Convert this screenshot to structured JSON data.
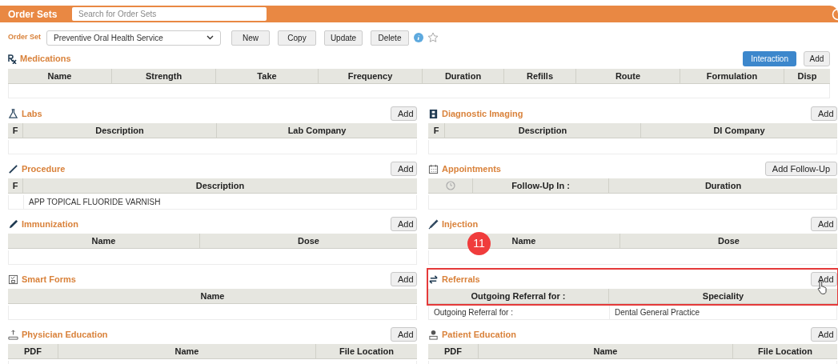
{
  "header": {
    "title": "Order Sets",
    "search": {
      "placeholder": "Search for Order Sets"
    }
  },
  "order_set": {
    "label": "Order Set",
    "value": "Preventive Oral Health Service",
    "buttons": [
      "New",
      "Copy",
      "Update",
      "Delete"
    ],
    "favorite": false
  },
  "medications": {
    "title": "Medications",
    "buttons": [
      {
        "label": "Interaction",
        "primary": true
      },
      {
        "label": "Add",
        "primary": false
      }
    ],
    "columns": [
      "Name",
      "Strength",
      "Take",
      "Frequency",
      "Duration",
      "Refills",
      "Route",
      "Formulation",
      "Disp"
    ]
  },
  "sections": [
    {
      "title": "Labs",
      "button": "Add",
      "highlighted": false,
      "columns": [
        {
          "kind": "text",
          "label": "F"
        },
        {
          "kind": "text",
          "label": "Description"
        },
        {
          "kind": "text",
          "label": "Lab Company"
        }
      ]
    },
    {
      "title": "Diagnostic Imaging",
      "button": "Add",
      "highlighted": false,
      "columns": [
        {
          "kind": "text",
          "label": "F"
        },
        {
          "kind": "text",
          "label": "Description"
        },
        {
          "kind": "text",
          "label": "DI Company"
        }
      ]
    },
    {
      "title": "Procedure",
      "button": "Add",
      "highlighted": false,
      "columns": [
        {
          "kind": "text",
          "label": "F"
        },
        {
          "kind": "text",
          "label": "Description"
        }
      ],
      "rows": [
        {
          "cells": [
            "",
            "APP TOPICAL FLUORIDE VARNISH"
          ]
        }
      ]
    },
    {
      "title": "Appointments",
      "button": "Add Follow-Up",
      "highlighted": false,
      "columns": [
        {
          "kind": "icon"
        },
        {
          "kind": "text",
          "label": "Follow-Up In :"
        },
        {
          "kind": "text",
          "label": "Duration"
        }
      ]
    },
    {
      "title": "Immunization",
      "button": "Add",
      "highlighted": false,
      "columns": [
        {
          "kind": "text",
          "label": "Name"
        },
        {
          "kind": "text",
          "label": "Dose"
        }
      ]
    },
    {
      "title": "Injection",
      "button": "Add",
      "highlighted": false,
      "columns": [
        {
          "kind": "text",
          "label": "Name"
        },
        {
          "kind": "text",
          "label": "Dose"
        }
      ]
    },
    {
      "title": "Smart Forms",
      "button": "Add",
      "highlighted": false,
      "columns": [
        {
          "kind": "text",
          "label": "Name"
        }
      ]
    },
    {
      "title": "Referrals",
      "button": "Add",
      "highlighted": true,
      "columns": [
        {
          "kind": "text",
          "label": "Outgoing Referral for :"
        },
        {
          "kind": "text",
          "label": "Speciality"
        }
      ],
      "rows": [
        {
          "cells": [
            "Outgoing Referral for :",
            "Dental General Practice"
          ]
        }
      ]
    },
    {
      "title": "Physician Education",
      "button": "Add",
      "highlighted": false,
      "columns": [
        {
          "kind": "text",
          "label": "PDF"
        },
        {
          "kind": "text",
          "label": "Name"
        },
        {
          "kind": "text",
          "label": "File Location"
        }
      ]
    },
    {
      "title": "Patient Education",
      "button": "Add",
      "highlighted": false,
      "columns": [
        {
          "kind": "text",
          "label": "PDF"
        },
        {
          "kind": "text",
          "label": "Name"
        },
        {
          "kind": "text",
          "label": "File Location"
        }
      ]
    }
  ],
  "annotation_badge": "11"
}
